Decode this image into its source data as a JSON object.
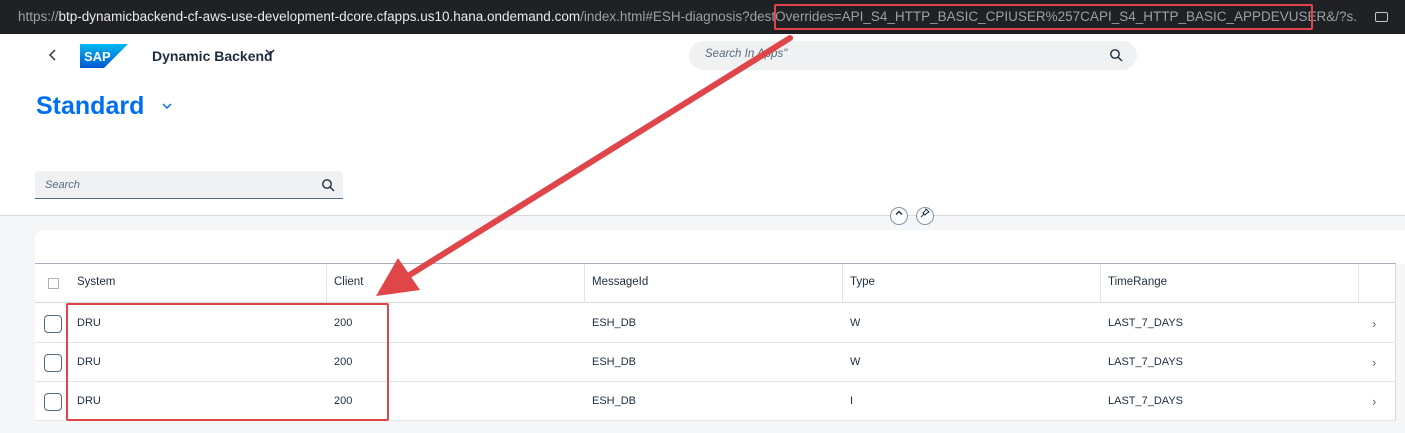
{
  "browser": {
    "url_scheme": "https://",
    "url_host": "btp-dynamicbackend-cf-aws-use-development-dcore.cfapps.us10.hana.ondemand.com",
    "url_rest": "/index.html#ESH-diagnosis?destOverrides=API_S4_HTTP_BASIC_CPIUSER%257CAPI_S4_HTTP_BASIC_APPDEVUSER&/?s..."
  },
  "shell": {
    "logo_text": "SAP",
    "app_title": "Dynamic Backend",
    "search_placeholder": "Search In Apps\""
  },
  "header": {
    "variant_title": "Standard",
    "search_placeholder": "Search"
  },
  "table": {
    "columns": [
      "System",
      "Client",
      "MessageId",
      "Type",
      "TimeRange"
    ],
    "rows": [
      {
        "system": "DRU",
        "client": "200",
        "message_id": "ESH_DB",
        "type": "W",
        "time_range": "LAST_7_DAYS"
      },
      {
        "system": "DRU",
        "client": "200",
        "message_id": "ESH_DB",
        "type": "W",
        "time_range": "LAST_7_DAYS"
      },
      {
        "system": "DRU",
        "client": "200",
        "message_id": "ESH_DB",
        "type": "I",
        "time_range": "LAST_7_DAYS"
      }
    ]
  },
  "icons": {
    "back": "chevron-left-icon",
    "shell_search": "search-icon",
    "filter_search": "search-icon",
    "collapse_header": "chevron-up-icon",
    "pin_header": "pin-icon",
    "row_nav": "chevron-right-icon"
  },
  "colors": {
    "accent": "#0070f2",
    "annotation": "#e0454a",
    "shell_background": "#ffffff",
    "browser_bar": "#202124"
  }
}
